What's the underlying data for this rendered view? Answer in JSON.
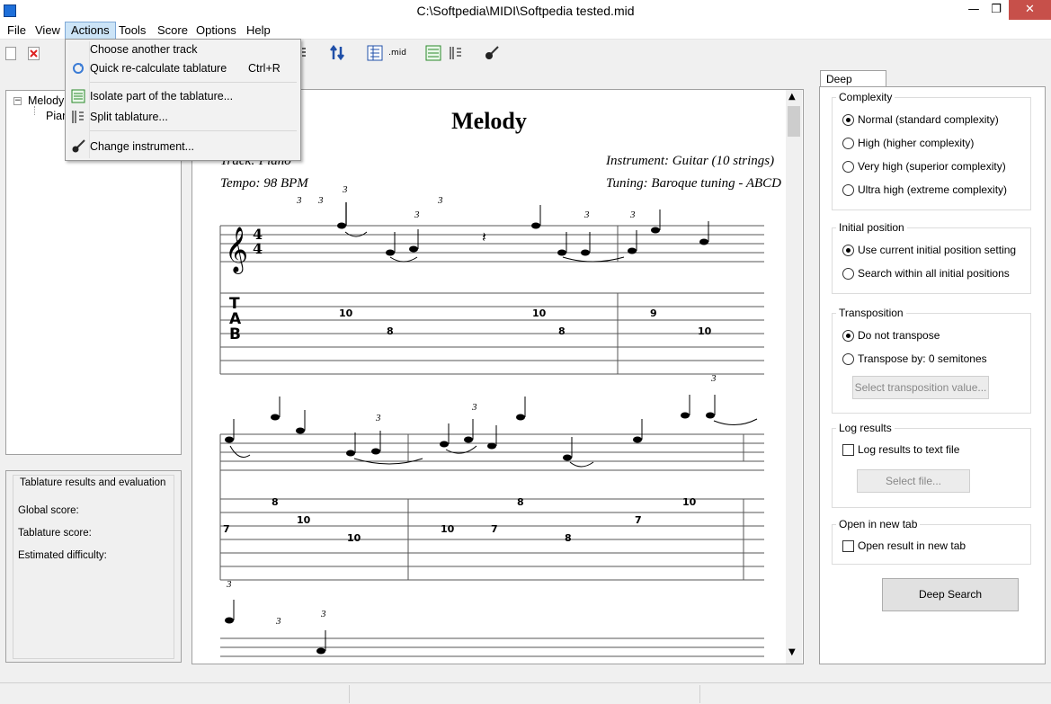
{
  "window": {
    "title": "C:\\Softpedia\\MIDI\\Softpedia tested.mid",
    "minimize": "—",
    "maximize": "❐",
    "close": "✕"
  },
  "menubar": {
    "items": [
      "File",
      "View",
      "Actions",
      "Tools",
      "Score",
      "Options",
      "Help"
    ],
    "active": "Actions"
  },
  "actions_menu": {
    "items": [
      {
        "label": "Choose another track",
        "shortcut": ""
      },
      {
        "label": "Quick re-calculate tablature",
        "shortcut": "Ctrl+R"
      },
      {
        "label": "Isolate part of the tablature...",
        "shortcut": ""
      },
      {
        "label": "Split tablature...",
        "shortcut": ""
      },
      {
        "label": "Change instrument...",
        "shortcut": ""
      }
    ]
  },
  "toolbar": {
    "mid_label": ".mid"
  },
  "tree": {
    "root": "Melody",
    "child": "Piano"
  },
  "results": {
    "title": "Tablature results and evaluation",
    "global_score": "Global score:",
    "tablature_score": "Tablature score:",
    "estimated_difficulty": "Estimated difficulty:"
  },
  "score": {
    "title": "Melody",
    "track": "Track: Piano",
    "tempo": "Tempo: 98 BPM",
    "instrument": "Instrument: Guitar (10 strings)",
    "tuning": "Tuning: Baroque tuning - ABCD",
    "tab_letters": [
      "T",
      "A",
      "B"
    ],
    "triplet_mark": "3",
    "row1_numbers": [
      "10",
      "8",
      "10",
      "8",
      "9",
      "10"
    ],
    "row2_numbers": [
      "7",
      "8",
      "10",
      "10",
      "10",
      "7",
      "8",
      "8",
      "7",
      "10"
    ]
  },
  "deep_search": {
    "tab_label": "Deep Search",
    "complexity": {
      "title": "Complexity",
      "options": [
        "Normal (standard complexity)",
        "High (higher complexity)",
        "Very high (superior complexity)",
        "Ultra high (extreme complexity)"
      ],
      "selected": 0
    },
    "initial_position": {
      "title": "Initial position",
      "options": [
        "Use current initial position setting",
        "Search within all initial positions"
      ],
      "selected": 0
    },
    "transposition": {
      "title": "Transposition",
      "options": [
        "Do not transpose",
        "Transpose by: 0 semitones"
      ],
      "selected": 0,
      "select_button": "Select transposition value..."
    },
    "log_results": {
      "title": "Log results",
      "checkbox": "Log results to text file",
      "select_button": "Select file..."
    },
    "open_new_tab": {
      "title": "Open in new tab",
      "checkbox": "Open result in new tab"
    },
    "button": "Deep Search"
  }
}
